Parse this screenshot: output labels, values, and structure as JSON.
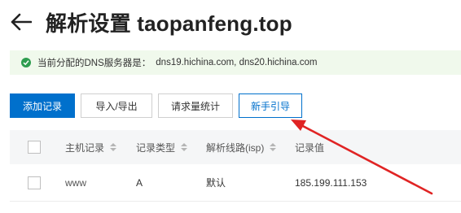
{
  "header": {
    "title": "解析设置 taopanfeng.top"
  },
  "notice": {
    "prefix": "当前分配的DNS服务器是：",
    "servers": "dns19.hichina.com, dns20.hichina.com"
  },
  "toolbar": {
    "add": "添加记录",
    "import_export": "导入/导出",
    "stats": "请求量统计",
    "guide": "新手引导"
  },
  "table": {
    "columns": [
      "主机记录",
      "记录类型",
      "解析线路(isp)",
      "记录值"
    ],
    "rows": [
      {
        "host": "www",
        "type": "A",
        "line": "默认",
        "value": "185.199.111.153"
      }
    ]
  },
  "colors": {
    "primary": "#0070cc",
    "success": "#2e9d4f",
    "notice_bg": "#f0f9ec",
    "annotation_arrow": "#e02424"
  }
}
